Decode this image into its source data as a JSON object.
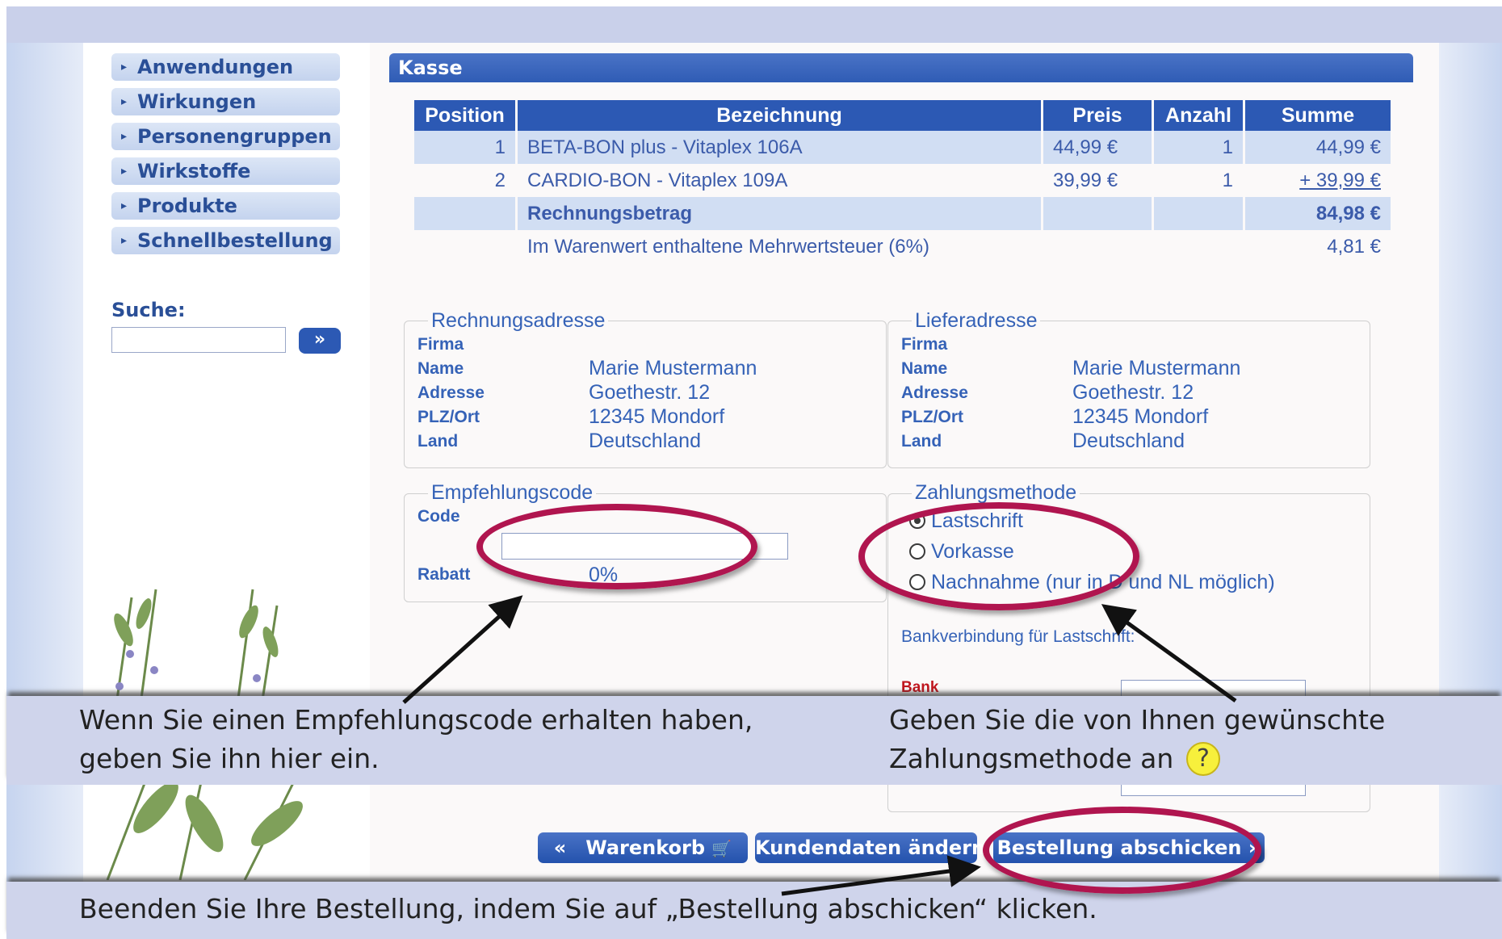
{
  "nav": {
    "items": [
      {
        "label": "Anwendungen"
      },
      {
        "label": "Wirkungen"
      },
      {
        "label": "Personengruppen"
      },
      {
        "label": "Wirkstoffe"
      },
      {
        "label": "Produkte"
      },
      {
        "label": "Schnellbestellung"
      }
    ],
    "arrow_icon": "▸"
  },
  "search": {
    "label": "Suche:",
    "button": "»",
    "value": ""
  },
  "kasse": {
    "title": "Kasse",
    "headers": [
      "Position",
      "Bezeichnung",
      "Preis",
      "Anzahl",
      "Summe"
    ],
    "rows": [
      {
        "pos": "1",
        "name": "BETA-BON plus - Vitaplex 106A",
        "price": "44,99 €",
        "qty": "1",
        "sum": "44,99 €"
      },
      {
        "pos": "2",
        "name": "CARDIO-BON - Vitaplex 109A",
        "price": "39,99 €",
        "qty": "1",
        "sum": "+  39,99 €"
      }
    ],
    "total_label": "Rechnungsbetrag",
    "total_value": "84,98 €",
    "vat_label": "Im Warenwert enthaltene Mehrwertsteuer (6%)",
    "vat_value": "4,81 €"
  },
  "billing": {
    "legend": "Rechnungsadresse",
    "labels": {
      "company": "Firma",
      "name": "Name",
      "address": "Adresse",
      "zip": "PLZ/Ort",
      "country": "Land"
    },
    "name": "Marie Mustermann",
    "address": "Goethestr. 12",
    "zip": "12345 Mondorf",
    "country": "Deutschland"
  },
  "shipping": {
    "legend": "Lieferadresse",
    "labels": {
      "company": "Firma",
      "name": "Name",
      "address": "Adresse",
      "zip": "PLZ/Ort",
      "country": "Land"
    },
    "name": "Marie Mustermann",
    "address": "Goethestr. 12",
    "zip": "12345 Mondorf",
    "country": "Deutschland"
  },
  "referral": {
    "legend": "Empfehlungscode",
    "code_label": "Code",
    "code_value": "",
    "discount_label": "Rabatt",
    "discount_value": "0%"
  },
  "payment": {
    "legend": "Zahlungsmethode",
    "options": [
      {
        "label": "Lastschrift",
        "selected": true
      },
      {
        "label": "Vorkasse",
        "selected": false
      },
      {
        "label": "Nachnahme (nur in D und NL möglich)",
        "selected": false
      }
    ],
    "bank_heading": "Bankverbindung für Lastschrift:",
    "bank_label": "Bank"
  },
  "buttons": {
    "cart": "Warenkorb",
    "cart_prefix": "«",
    "cart_icon": "🛒",
    "edit": "Kundendaten ändern",
    "submit": "Bestellung abschicken",
    "submit_suffix": "»"
  },
  "annotations": {
    "referral_line1": "Wenn Sie einen Empfehlungscode erhalten haben,",
    "referral_line2": "geben Sie ihn hier ein.",
    "payment_line1": "Geben Sie die von Ihnen gewünschte",
    "payment_line2": "Zahlungsmethode an",
    "help_icon": "?",
    "submit_hint": "Beenden Sie Ihre Bestellung, indem Sie auf „Bestellung abschicken“ klicken."
  },
  "colors": {
    "brand_blue": "#2c59b4",
    "highlight_ellipse": "#b0154f",
    "light_row": "#d1def3",
    "help_yellow": "#f7f03c"
  }
}
